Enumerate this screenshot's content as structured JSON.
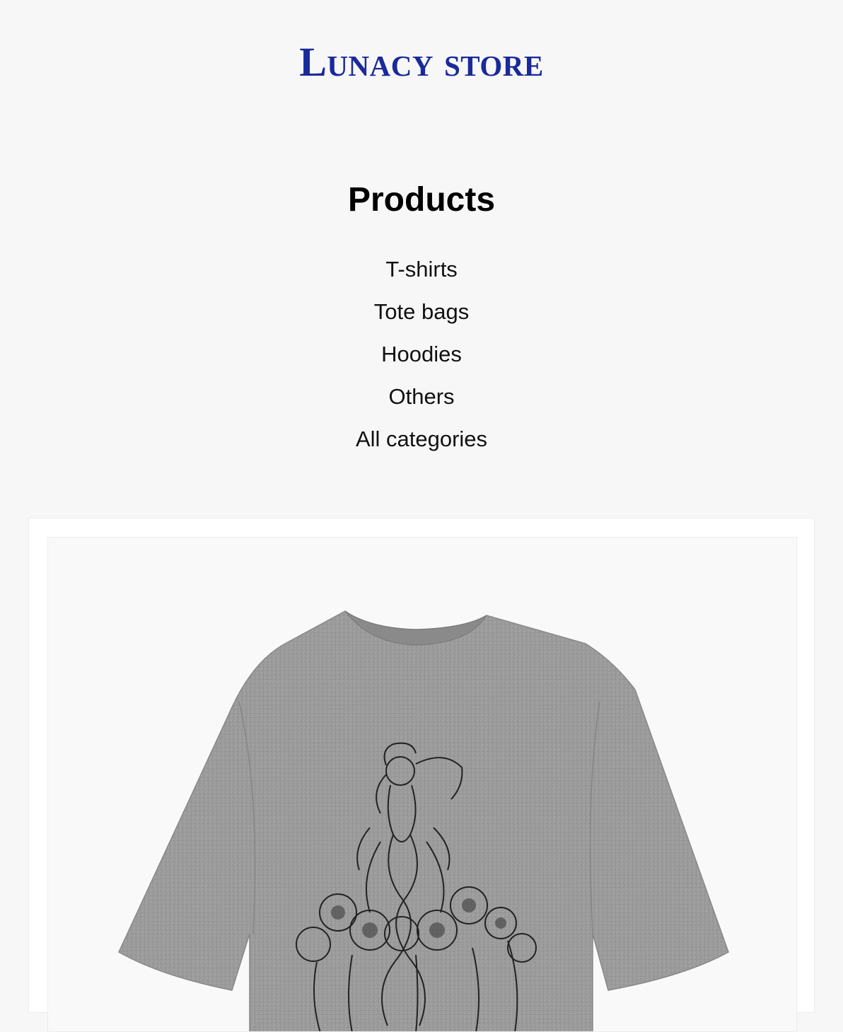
{
  "store": {
    "name": "Lunacy store"
  },
  "products_section": {
    "title": "Products",
    "categories": [
      {
        "label": "T-shirts"
      },
      {
        "label": "Tote bags"
      },
      {
        "label": "Hoodies"
      },
      {
        "label": "Others"
      },
      {
        "label": "All categories"
      }
    ]
  },
  "colors": {
    "brand": "#1a2a9a",
    "background": "#f7f7f7",
    "shirt": "#9a9a9a"
  },
  "featured_product": {
    "image": "grey-tshirt-illustration"
  }
}
